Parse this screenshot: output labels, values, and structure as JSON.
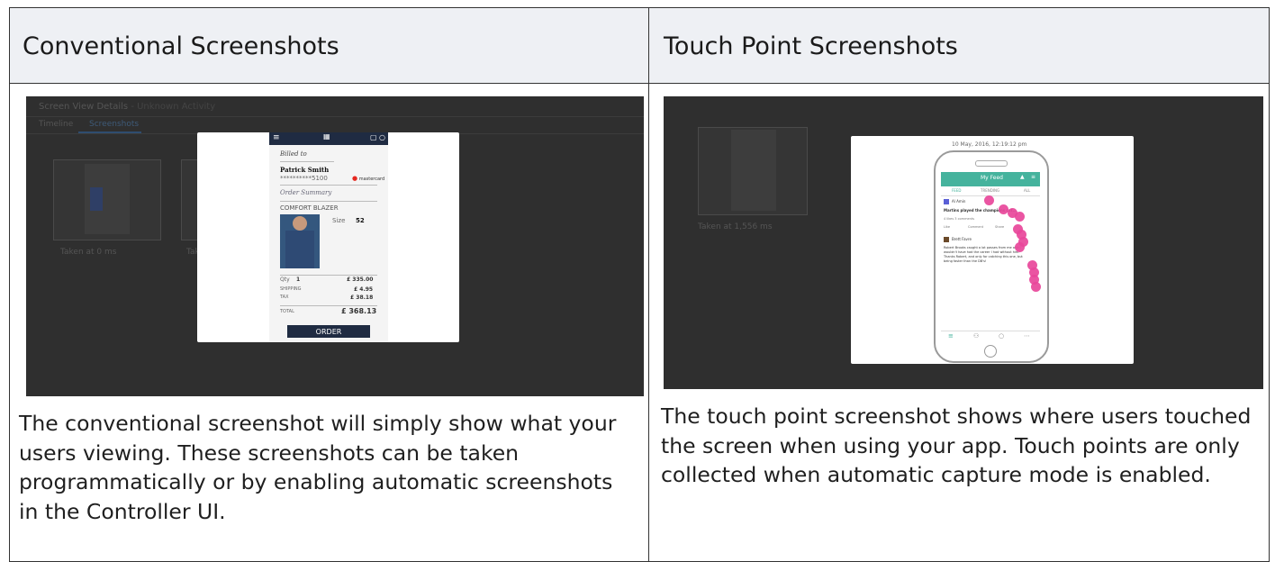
{
  "headers": {
    "conventional": "Conventional Screenshots",
    "touch": "Touch Point Screenshots"
  },
  "descriptions": {
    "conventional": "The conventional screenshot will simply show what your users viewing. These screenshots can be taken programmatically or by enabling automatic screenshots in the Controller UI.",
    "touch": "The touch point screenshot shows where users touched the screen when using your app. Touch points are only collected when automatic capture mode is enabled."
  },
  "conventional_shot": {
    "title": "Screen View Details",
    "subtitle": "- Unknown Activity",
    "tab_timeline": "Timeline",
    "tab_screenshots": "Screenshots",
    "thumb_caption": "Taken at 0 ms",
    "thumb_caption_partial": "Tak",
    "page": {
      "billed_to": "Billed to",
      "name": "Patrick Smith",
      "card": "**********5100",
      "card_brand": "mastercard",
      "order_summary": "Order Summary",
      "product": "COMFORT BLAZER",
      "size_label": "Size",
      "size_value": "52",
      "qty_label": "Qty",
      "qty_value": "1",
      "price": "£ 335.00",
      "shipping_label": "SHIPPING",
      "shipping_value": "£ 4.95",
      "tax_label": "TAX",
      "tax_value": "£ 38.18",
      "total_label": "TOTAL",
      "total_value": "£ 368.13",
      "order_button": "ORDER"
    }
  },
  "touch_shot": {
    "thumb_caption": "Taken at 1,556 ms",
    "timestamp": "10 May, 2016, 12:19:12 pm",
    "feed_title": "My Feed",
    "tabs": [
      "FEED",
      "TRENDING",
      "ALL"
    ],
    "post1_user": "Al Amin",
    "post1_text": "Martins played the champions cat...",
    "post1_meta": "4 likes  3 comments",
    "post1_actions": [
      "Like",
      "Comment",
      "Share"
    ],
    "post2_user": "Brett Favre",
    "post2_text": "Robert Brooks caught a lot passes from me and I wouldn't have had the career I had without him. Thanks Robert, and only for catching this one, but being faster than the DB's!"
  },
  "colors": {
    "header_bg": "#eef0f4",
    "screenshot_bg": "#2f2f2f",
    "touch_dot": "#e8479a",
    "feed_teal": "#45b39d",
    "nav_navy": "#1f2b42"
  }
}
